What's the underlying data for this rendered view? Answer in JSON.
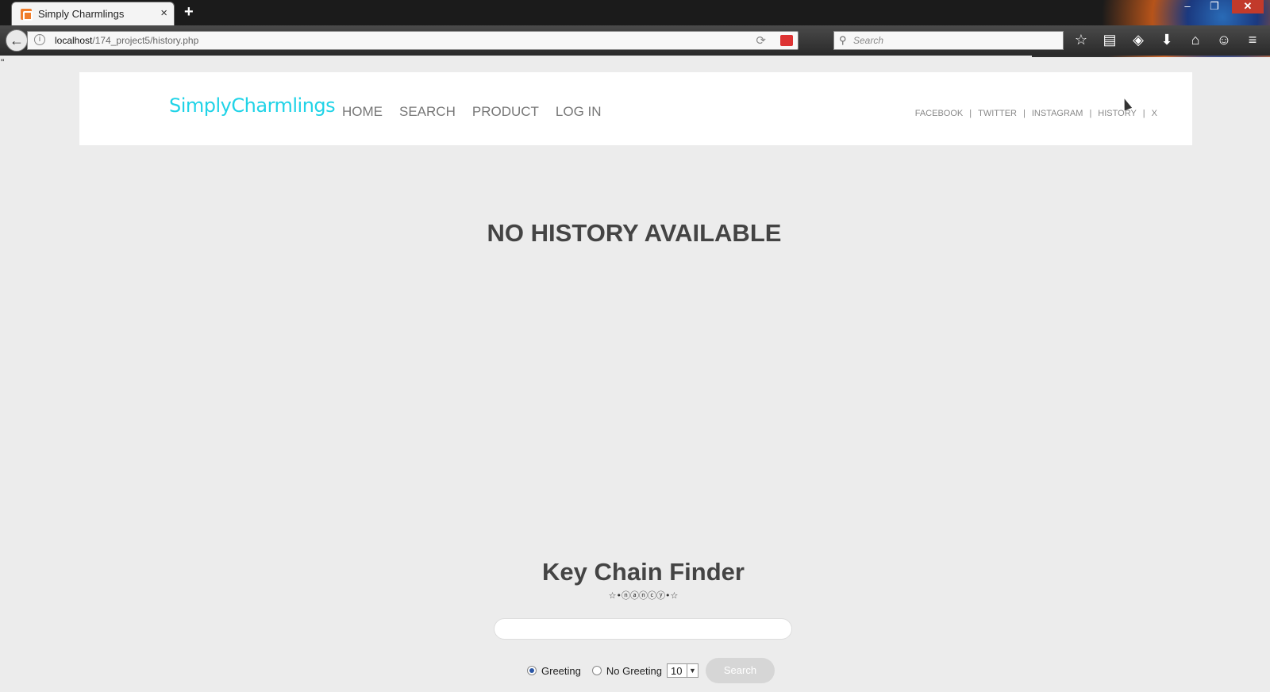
{
  "browser": {
    "tab_title": "Simply Charmlings",
    "tab_close": "×",
    "new_tab": "+",
    "url_host": "localhost",
    "url_path": "/174_project5/history.php",
    "search_placeholder": "Search",
    "window_buttons": [
      "–",
      "❐",
      "✕"
    ]
  },
  "page": {
    "stray_mark": "\"",
    "logo": "SimplyCharmlings",
    "main_nav": [
      "HOME",
      "SEARCH",
      "PRODUCT",
      "LOG IN"
    ],
    "social_nav": [
      "FACEBOOK",
      "TWITTER",
      "INSTAGRAM",
      "HISTORY",
      "X"
    ],
    "separator": "|",
    "message": "NO HISTORY AVAILABLE"
  },
  "finder": {
    "title": "Key Chain Finder",
    "subtitle": "☆•ⓝⓐⓝⓒⓨ•☆",
    "input_value": "",
    "greeting_label": "Greeting",
    "no_greeting_label": "No Greeting",
    "count_value": "10",
    "search_label": "Search",
    "greeting_selected": true
  }
}
